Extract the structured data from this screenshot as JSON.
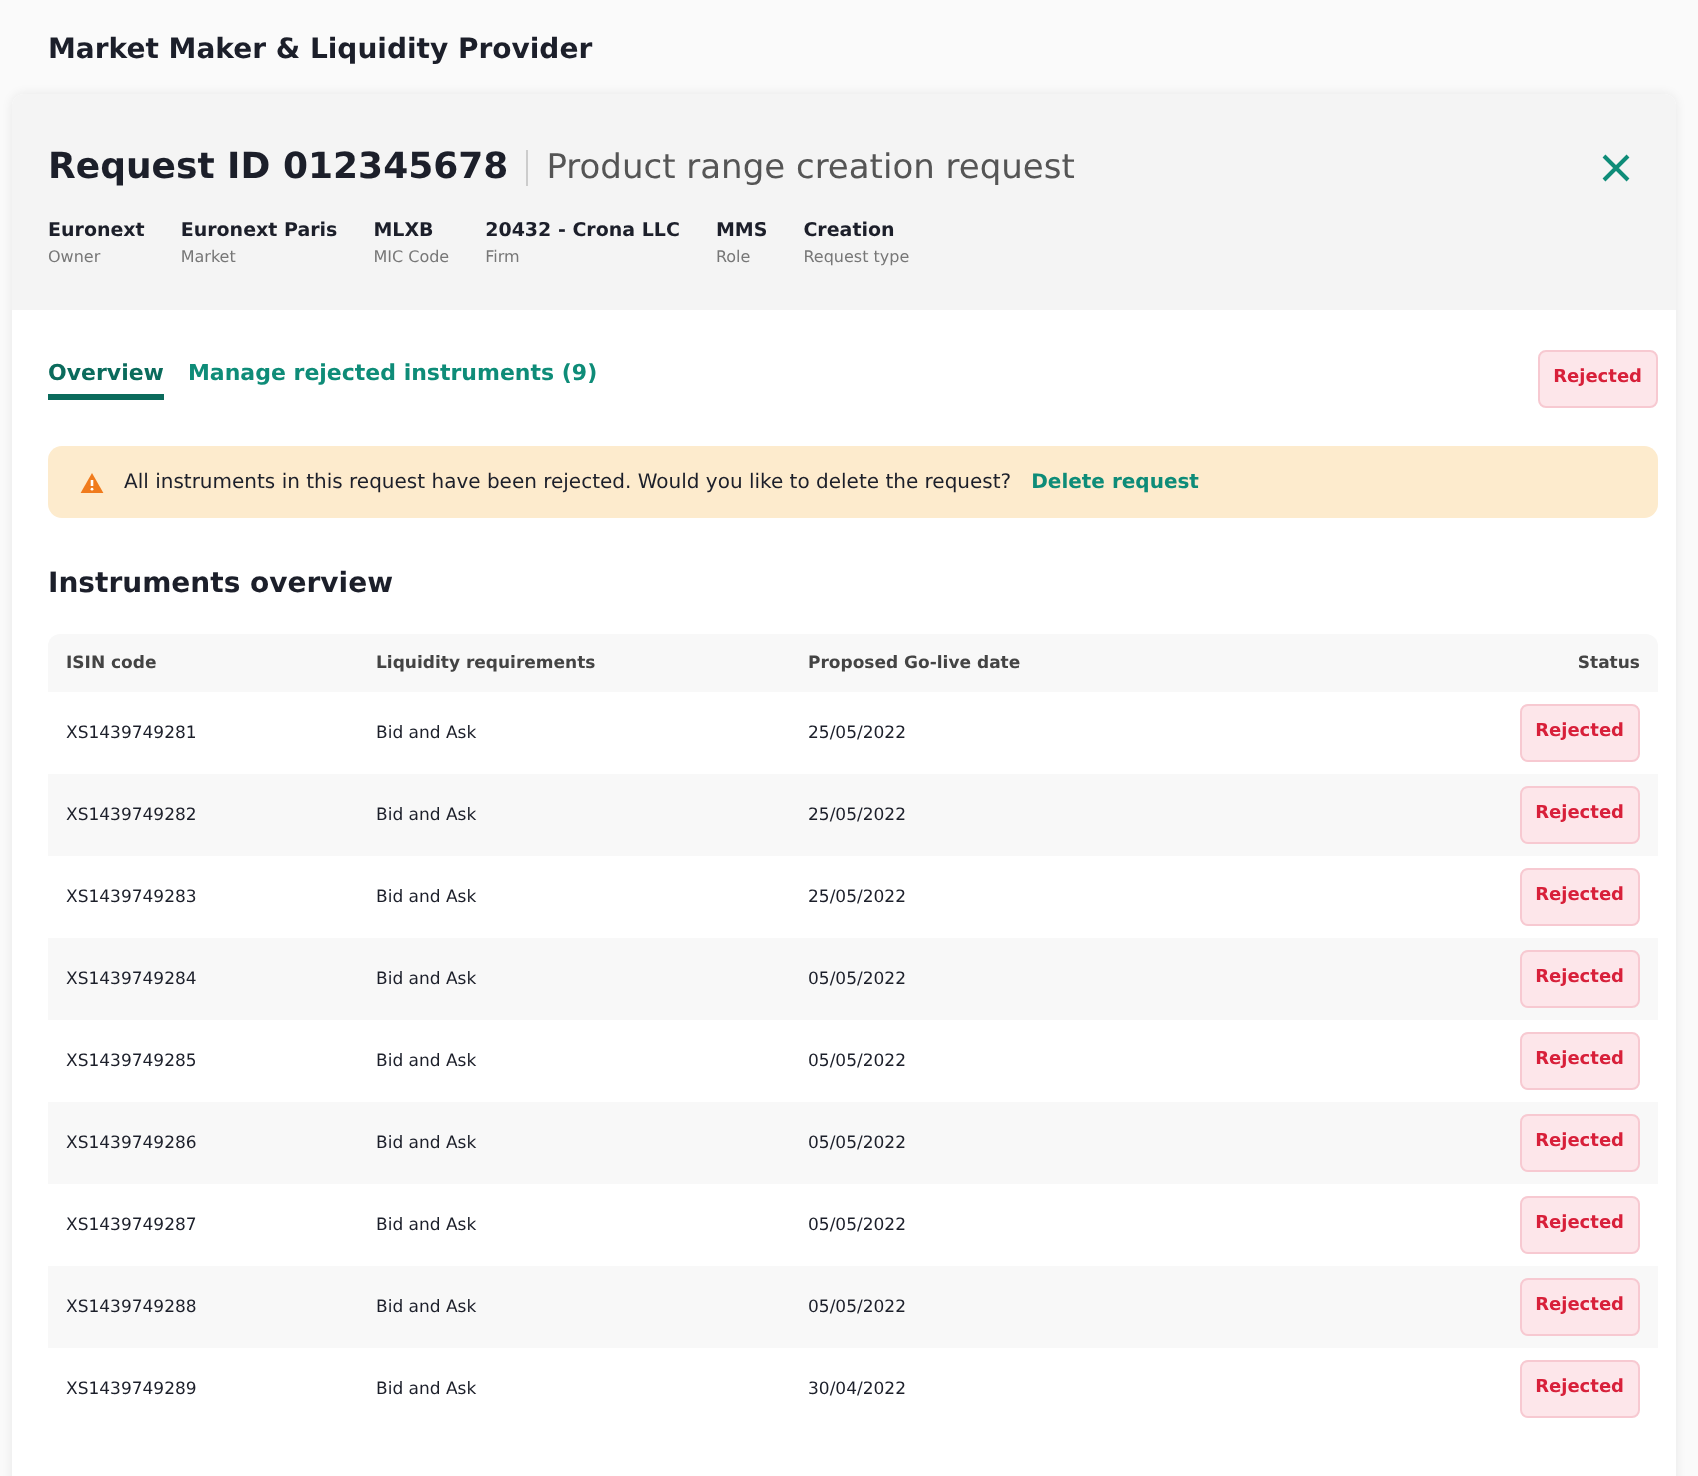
{
  "page_title": "Market Maker & Liquidity Provider",
  "request": {
    "id_label": "Request ID 012345678",
    "subtitle": "Product range creation request",
    "meta": [
      {
        "value": "Euronext",
        "label": "Owner"
      },
      {
        "value": "Euronext Paris",
        "label": "Market"
      },
      {
        "value": "MLXB",
        "label": "MIC Code"
      },
      {
        "value": "20432 - Crona LLC",
        "label": "Firm"
      },
      {
        "value": "MMS",
        "label": "Role"
      },
      {
        "value": "Creation",
        "label": "Request type"
      }
    ]
  },
  "tabs": [
    {
      "label": "Overview",
      "selected": true
    },
    {
      "label": "Manage rejected instruments (9)",
      "selected": false
    }
  ],
  "status_badge": "Rejected",
  "alert": {
    "message": "All instruments in this request have been rejected. Would you like to delete the request?",
    "link": "Delete request"
  },
  "section_title": "Instruments overview",
  "table": {
    "columns": [
      "ISIN code",
      "Liquidity requirements",
      "Proposed Go-live date",
      "Status"
    ],
    "rows": [
      {
        "isin": "XS1439749281",
        "liquidity": "Bid and Ask",
        "date": "25/05/2022",
        "status": "Rejected"
      },
      {
        "isin": "XS1439749282",
        "liquidity": "Bid and Ask",
        "date": "25/05/2022",
        "status": "Rejected"
      },
      {
        "isin": "XS1439749283",
        "liquidity": "Bid and Ask",
        "date": "25/05/2022",
        "status": "Rejected"
      },
      {
        "isin": "XS1439749284",
        "liquidity": "Bid and Ask",
        "date": "05/05/2022",
        "status": "Rejected"
      },
      {
        "isin": "XS1439749285",
        "liquidity": "Bid and Ask",
        "date": "05/05/2022",
        "status": "Rejected"
      },
      {
        "isin": "XS1439749286",
        "liquidity": "Bid and Ask",
        "date": "05/05/2022",
        "status": "Rejected"
      },
      {
        "isin": "XS1439749287",
        "liquidity": "Bid and Ask",
        "date": "05/05/2022",
        "status": "Rejected"
      },
      {
        "isin": "XS1439749288",
        "liquidity": "Bid and Ask",
        "date": "05/05/2022",
        "status": "Rejected"
      },
      {
        "isin": "XS1439749289",
        "liquidity": "Bid and Ask",
        "date": "30/04/2022",
        "status": "Rejected"
      }
    ]
  }
}
